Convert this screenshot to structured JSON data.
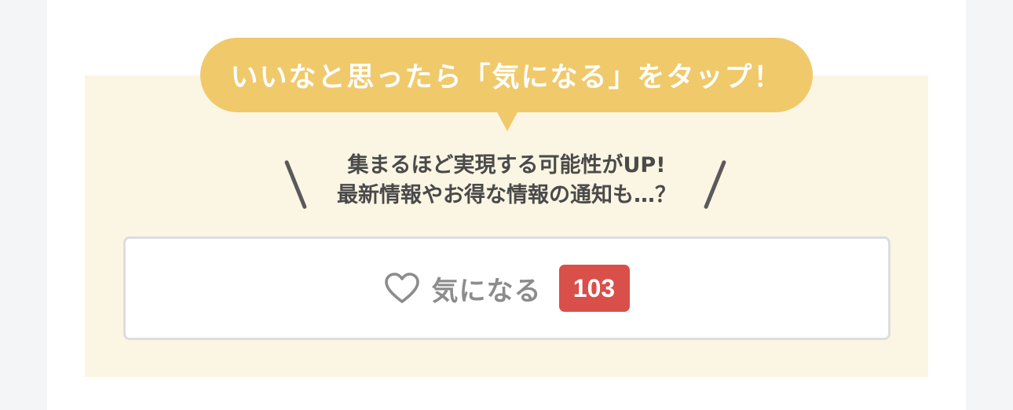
{
  "callout": {
    "text": "いいなと思ったら「気になる」をタップ！"
  },
  "message": {
    "line1": "集まるほど実現する可能性がUP!",
    "line2": "最新情報やお得な情報の通知も…？"
  },
  "like_button": {
    "label": "気になる",
    "count": "103",
    "icon": "heart-outline-icon"
  },
  "colors": {
    "callout_bg": "#f0c96b",
    "panel_bg": "#fbf5e3",
    "badge_bg": "#d94f4a",
    "label_text": "#8c8c8c"
  }
}
